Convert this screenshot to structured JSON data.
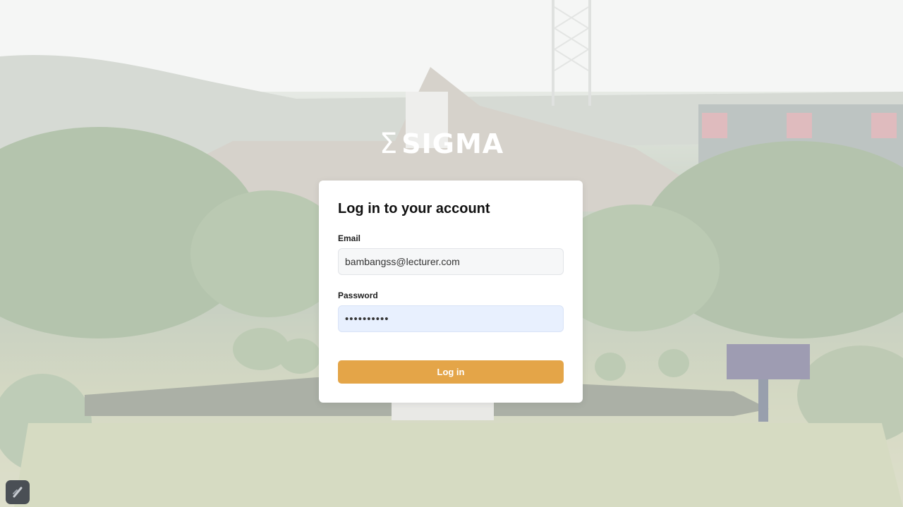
{
  "brand": {
    "logo_glyph": "Σ",
    "logo_text": "SIGMA"
  },
  "login_form": {
    "title": "Log in to your account",
    "email_label": "Email",
    "email_value": "bambangss@lecturer.com",
    "password_label": "Password",
    "password_value": "••••••••••",
    "submit_label": "Log in"
  },
  "colors": {
    "accent": "#e4a548",
    "password_autofill_bg": "#e8f0fe",
    "card_bg": "#ffffff"
  },
  "icons": {
    "corner_button": "slash-toolbar-icon"
  }
}
